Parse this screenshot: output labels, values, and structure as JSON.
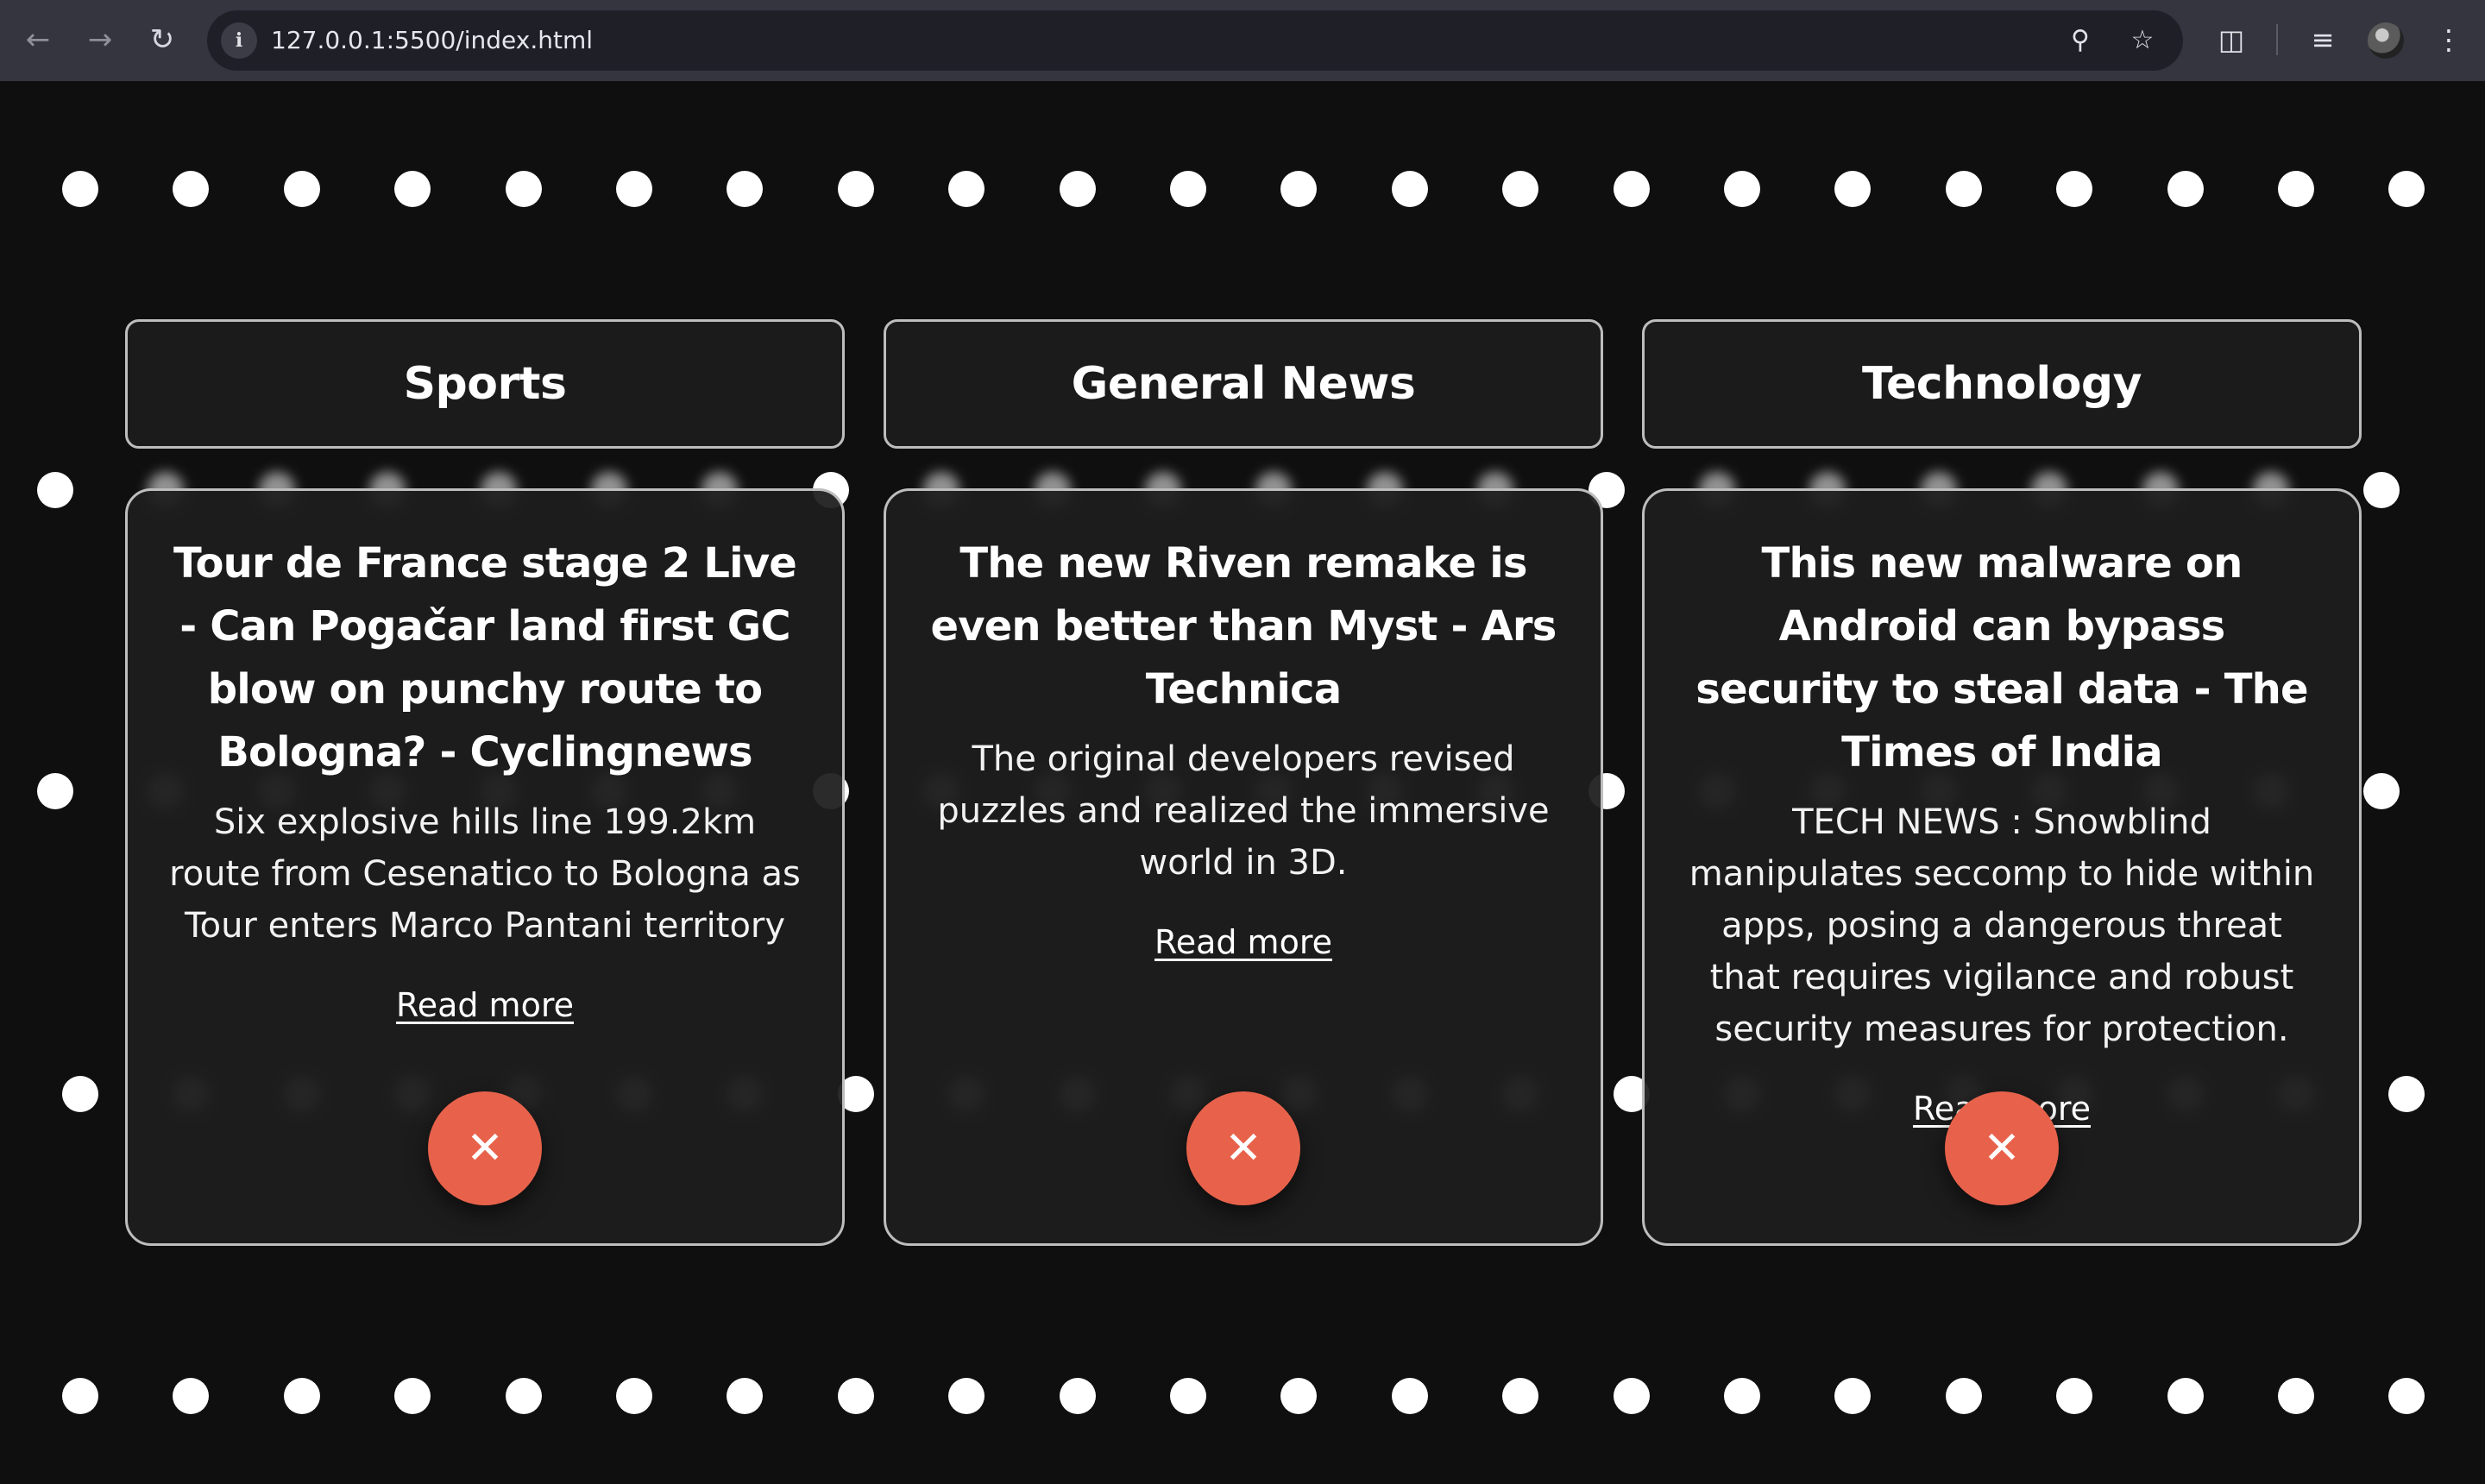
{
  "browser": {
    "url": "127.0.0.1:5500/index.html",
    "icons": [
      "back-icon",
      "forward-icon",
      "reload-icon",
      "site-info-icon",
      "zoom-icon",
      "bookmark-star-icon",
      "extensions-icon",
      "reading-list-icon",
      "profile-avatar",
      "menu-icon"
    ]
  },
  "columns": [
    {
      "heading": "Sports",
      "card": {
        "title": "Tour de France stage 2 Live - Can Pogačar land first GC blow on punchy route to Bologna? - Cyclingnews",
        "description": "Six explosive hills line 199.2km route from Cesenatico to Bologna as Tour enters Marco Pantani territory",
        "link": "Read more",
        "close_label": "✕"
      }
    },
    {
      "heading": "General News",
      "card": {
        "title": "The new Riven remake is even better than Myst - Ars Technica",
        "description": "The original developers revised puzzles and realized the immersive world in 3D.",
        "link": "Read more",
        "close_label": "✕"
      }
    },
    {
      "heading": "Technology",
      "card": {
        "title": "This new malware on Android can bypass security to steal data - The Times of India",
        "description": "TECH NEWS : Snowblind manipulates seccomp to hide within apps, posing a dangerous threat that requires vigilance and robust security measures for protection.",
        "link": "Read more",
        "close_label": "✕"
      }
    }
  ],
  "colors": {
    "background": "#0f0f0f",
    "card_border": "#bdbdbd",
    "close_button": "#e8624b",
    "dot": "#ffffff"
  }
}
